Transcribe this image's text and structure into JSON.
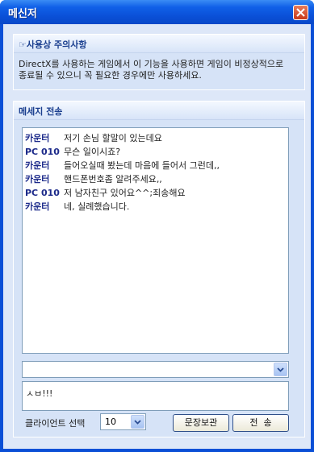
{
  "window": {
    "title": "메신저"
  },
  "notice_panel": {
    "title": "☞사용상 주의사항",
    "text": "DirectX를 사용하는 게임에서 이 기능을 사용하면 게임이 비정상적으로 종료될 수 있으니 꼭 필요한 경우에만 사용하세요."
  },
  "message_panel": {
    "title": "메세지 전송",
    "chat": [
      {
        "sender": "카운터",
        "text": "저기 손님 할말이 있는데요"
      },
      {
        "sender": "PC 010",
        "text": "무슨 일이시죠?"
      },
      {
        "sender": "카운터",
        "text": "들어오실때 봤는데 마음에 들어서 그런데,,"
      },
      {
        "sender": "카운터",
        "text": "핸드폰번호좀 알려주세요,,"
      },
      {
        "sender": "PC 010",
        "text": "저 남자친구 있어요^^;죄송해요"
      },
      {
        "sender": "카운터",
        "text": "네, 실례했습니다."
      }
    ],
    "history_combo_value": "",
    "input_value": "ㅅㅂ!!!",
    "client_label": "클라이언트 선택",
    "client_selected": "10",
    "save_button": "문장보관",
    "send_button": "전  송"
  },
  "colors": {
    "title_bar": "#0a4fd6",
    "panel_title": "#1b3f8f",
    "sender": "#1c2a8a",
    "close": "#c8391a"
  },
  "icons": [
    "close-icon",
    "dropdown-arrow-icon"
  ]
}
